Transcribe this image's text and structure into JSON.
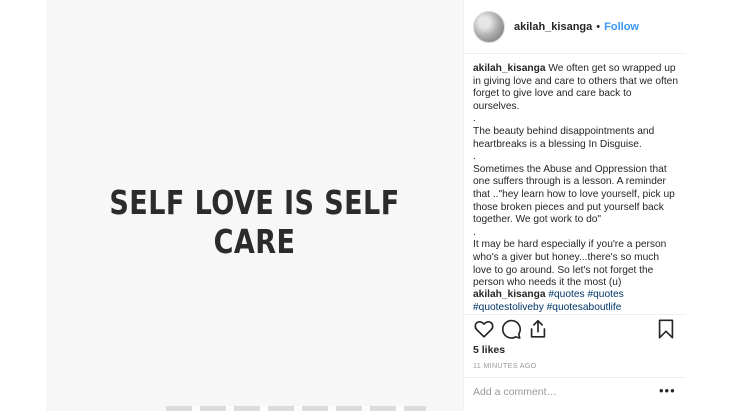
{
  "post_image": {
    "text": "SELF LOVE IS SELF CARE"
  },
  "header": {
    "username": "akilah_kisanga",
    "separator": "•",
    "follow_label": "Follow"
  },
  "caption": {
    "username": "akilah_kisanga",
    "paragraphs": [
      "We often get so wrapped up in giving love and care to others that we often forget to give love and care back to ourselves.",
      ".",
      "The beauty behind disappointments and heartbreaks is a blessing In Disguise.",
      ".",
      "Sometimes the Abuse and Oppression that one suffers through is a lesson. A reminder that ..\"hey learn how to love yourself, pick up those broken pieces and put yourself back together. We got work to do\"",
      ".",
      "It may be hard especially if you're a person who's a giver but honey...there's so much love to go around. So let's not forget the person who needs it the most (u)"
    ]
  },
  "hashtag_comment": {
    "username": "akilah_kisanga",
    "tags": [
      "#quotes",
      "#quotes",
      "#quotestoliveby",
      "#quotesaboutlife"
    ]
  },
  "actions": {
    "icons": [
      "heart-icon",
      "comment-icon",
      "share-icon",
      "bookmark-icon"
    ]
  },
  "likes": "5 likes",
  "timestamp": "11 MINUTES AGO",
  "comment_box": {
    "placeholder": "Add a comment…",
    "more_label": "•••"
  },
  "colors": {
    "link": "#3897f0",
    "hashtag": "#003569",
    "muted": "#999999",
    "text": "#262626"
  }
}
